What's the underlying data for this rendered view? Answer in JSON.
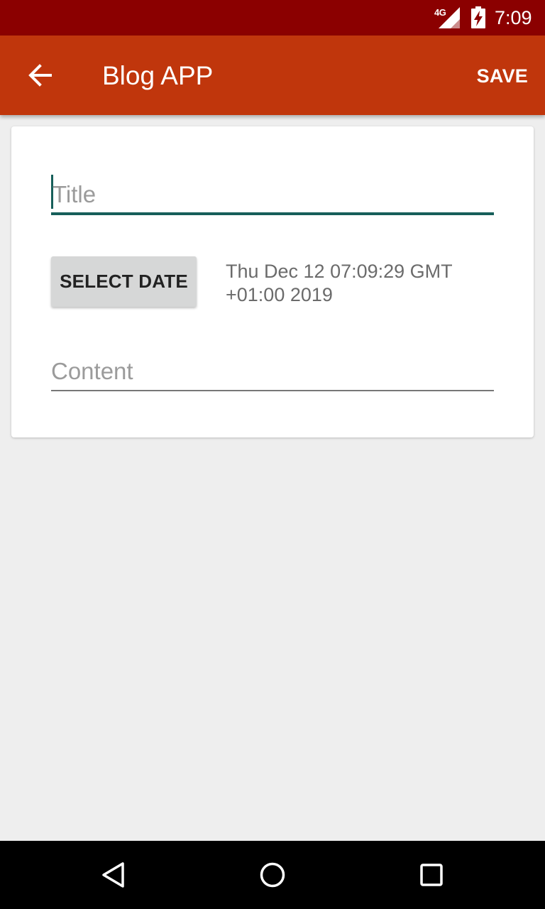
{
  "status_bar": {
    "network": "4G",
    "time": "7:09"
  },
  "toolbar": {
    "title": "Blog APP",
    "save_label": "SAVE"
  },
  "form": {
    "title_placeholder": "Title",
    "select_date_label": "SELECT DATE",
    "date_value": "Thu Dec 12 07:09:29 GMT +01:00 2019",
    "content_placeholder": "Content"
  },
  "colors": {
    "status_bar": "#8b0000",
    "toolbar": "#c0360c",
    "accent": "#175f5a",
    "background": "#eeeeee"
  },
  "icons": {
    "toolbar": [
      "arrow-left-icon"
    ],
    "status": [
      "signal-icon",
      "battery-charging-icon"
    ],
    "navigation": [
      "back-triangle-icon",
      "home-circle-icon",
      "recents-square-icon"
    ]
  }
}
